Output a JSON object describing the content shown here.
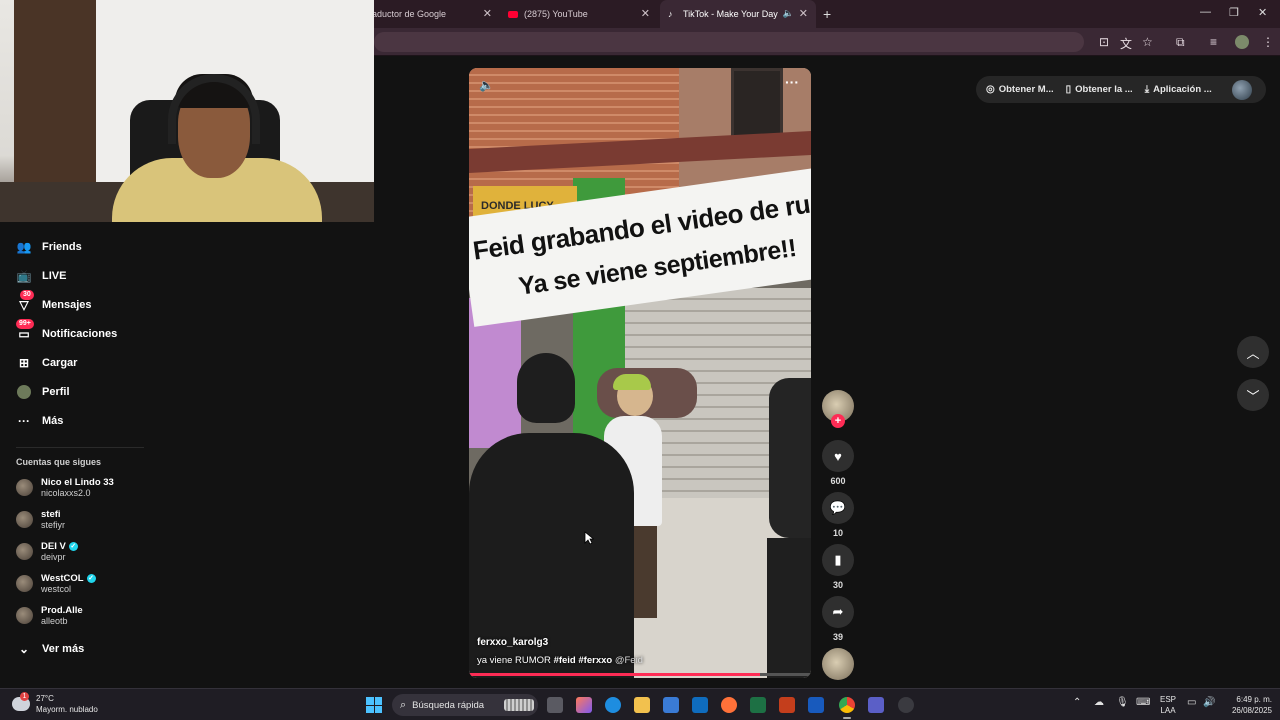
{
  "browser": {
    "tabs": [
      {
        "title": "aductor de Google",
        "active": false
      },
      {
        "title": "(2875) YouTube",
        "active": false
      },
      {
        "title": "TikTok - Make Your Day",
        "active": true
      }
    ],
    "new_tab_icon": "plus",
    "window_controls": [
      "minimize",
      "restore",
      "close"
    ]
  },
  "sidebar": {
    "nav": [
      {
        "label": "Friends",
        "icon": "friends-icon"
      },
      {
        "label": "LIVE",
        "icon": "live-icon"
      },
      {
        "label": "Mensajes",
        "icon": "messages-icon",
        "badge": "30"
      },
      {
        "label": "Notificaciones",
        "icon": "notifications-icon",
        "badge": "99+"
      },
      {
        "label": "Cargar",
        "icon": "upload-icon"
      },
      {
        "label": "Perfil",
        "icon": "profile-icon"
      },
      {
        "label": "Más",
        "icon": "more-icon"
      }
    ],
    "following_title": "Cuentas que sigues",
    "following": [
      {
        "name": "Nico el Lindo 33",
        "user": "nicolaxxs2.0",
        "verified": false
      },
      {
        "name": "stefi",
        "user": "stefiyr",
        "verified": false
      },
      {
        "name": "DEI V",
        "user": "deivpr",
        "verified": true
      },
      {
        "name": "WestCOL",
        "user": "westcol",
        "verified": true
      },
      {
        "name": "Prod.Alle",
        "user": "alleotb",
        "verified": false
      }
    ],
    "see_more": "Ver más"
  },
  "top_pill": {
    "items": [
      "Obtener M...",
      "Obtener la ...",
      "Aplicación ..."
    ]
  },
  "video": {
    "overlay_line1": "Feid grabando el video de ru mor!",
    "overlay_line2": "Ya se viene septiembre!!",
    "sign_text": "DONDE LUCY",
    "author": "ferxxo_karolg3",
    "caption_text": "ya viene RUMOR",
    "hashtags": [
      "#feid",
      "#ferxxo"
    ],
    "mention": "@Feid",
    "progress": 0.85
  },
  "actions": {
    "likes": "600",
    "comments": "10",
    "saves": "30",
    "shares": "39"
  },
  "taskbar": {
    "weather_temp": "27°C",
    "weather_desc": "Mayorm. nublado",
    "weather_badge": "1",
    "search_placeholder": "Búsqueda rápida",
    "lang_line1": "ESP",
    "lang_line2": "LAA",
    "time": "6:49 p. m.",
    "date": "26/08/2025"
  },
  "colors": {
    "accent": "#fe2c55",
    "verified": "#20d5ec",
    "background": "#121212"
  }
}
